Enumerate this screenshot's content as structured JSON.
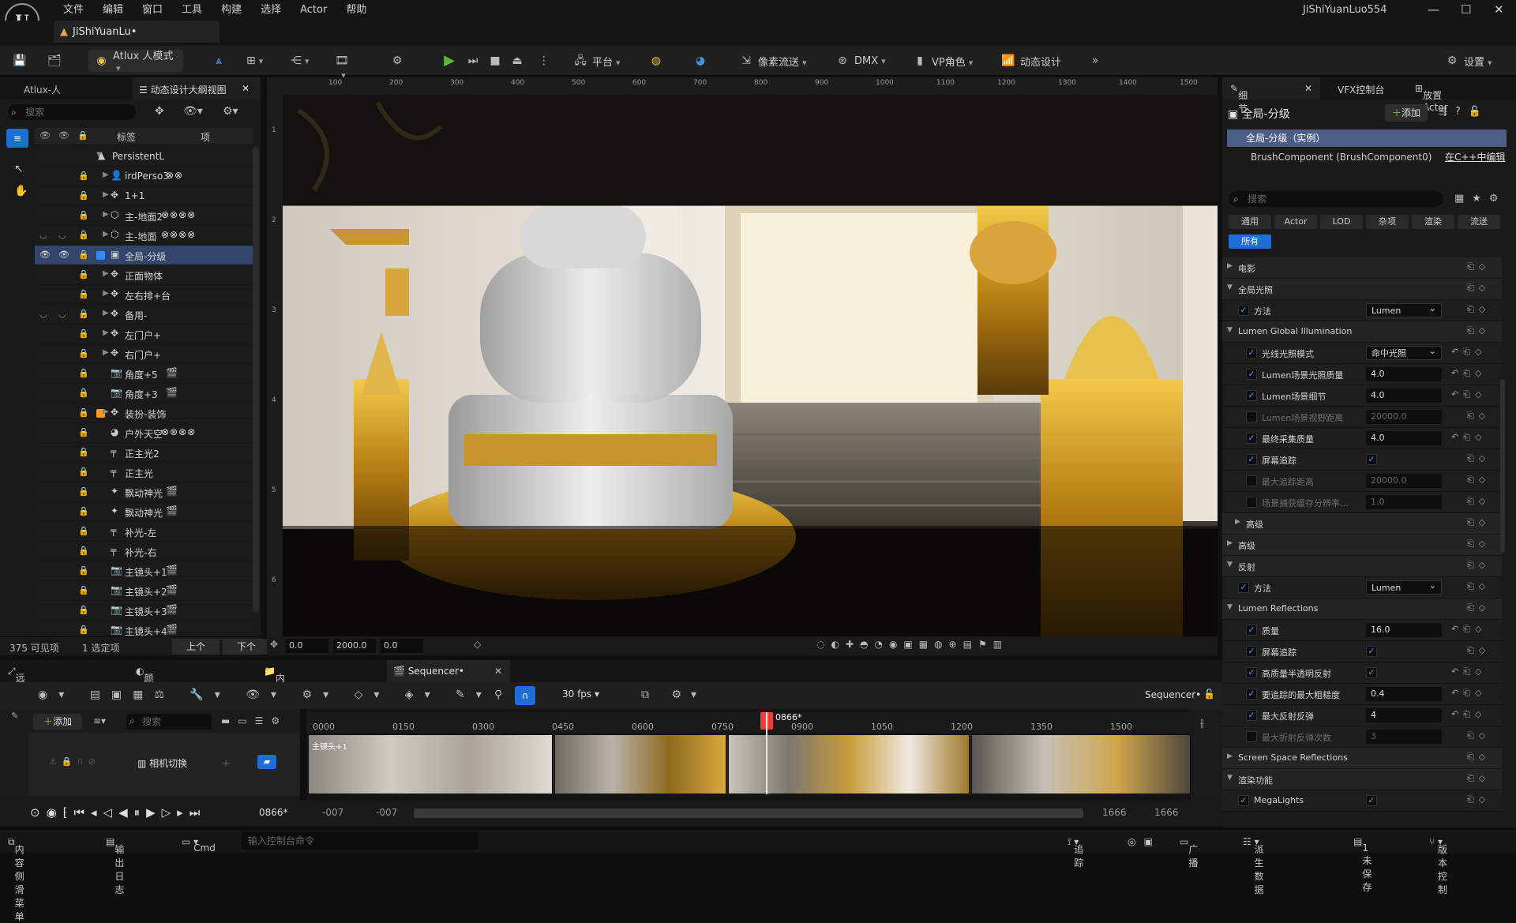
{
  "menubar": {
    "logo": "U",
    "items": [
      "文件",
      "编辑",
      "窗口",
      "工具",
      "构建",
      "选择",
      "Actor",
      "帮助"
    ],
    "user": "JiShiYuanLuo554",
    "project_tab": "JiShiYuanLu•"
  },
  "toolbar": {
    "mode": "Atlux 人模式",
    "platform": "平台",
    "pixel_stream": "像素流送",
    "dmx": "DMX",
    "vp_role": "VP角色",
    "motion_design": "动态设计",
    "settings": "设置"
  },
  "left_panel": {
    "tab1": "Atlux-人",
    "tab2": "动态设计大纲视图",
    "search_placeholder": "搜索",
    "col_label": "标签",
    "col_item": "项",
    "rows": [
      {
        "label": "PersistentL",
        "icon": "level-icon",
        "indent": 0,
        "expanded": true
      },
      {
        "label": "irdPerso3",
        "icon": "person-icon",
        "ext": "⊗⊗"
      },
      {
        "label": "1+1",
        "icon": "move-icon"
      },
      {
        "label": "主-地面2",
        "icon": "mesh-icon",
        "ext": "⊗⊗⊗⊗"
      },
      {
        "label": "主-地面",
        "icon": "mesh-icon",
        "ext": "⊗⊗⊗⊗",
        "eyes": true
      },
      {
        "label": "全局-分级",
        "icon": "grading-icon",
        "selected": true,
        "swatch": "#2f8cff"
      },
      {
        "label": "正面物体",
        "icon": "move-icon"
      },
      {
        "label": "左右排+台",
        "icon": "move-icon"
      },
      {
        "label": "备用-",
        "icon": "move-icon",
        "eyes": true
      },
      {
        "label": "左门户+",
        "icon": "move-icon"
      },
      {
        "label": "右门户+",
        "icon": "move-icon"
      },
      {
        "label": "角度+5",
        "icon": "camera-icon",
        "ext": "🎬"
      },
      {
        "label": "角度+3",
        "icon": "camera-icon",
        "ext": "🎬"
      },
      {
        "label": "装扮-装饰",
        "icon": "move-icon",
        "swatch": "#ff9a1a"
      },
      {
        "label": "户外天空",
        "icon": "sky-icon",
        "ext": "⊗⊗⊗⊗"
      },
      {
        "label": "正主光2",
        "icon": "light-icon"
      },
      {
        "label": "正主光",
        "icon": "light-icon"
      },
      {
        "label": "飘动神光",
        "icon": "spot-icon",
        "ext": "🎬"
      },
      {
        "label": "飘动神光",
        "icon": "spot-icon",
        "ext": "🎬"
      },
      {
        "label": "补光-左",
        "icon": "light-icon"
      },
      {
        "label": "补光-右",
        "icon": "light-icon"
      },
      {
        "label": "主镜头+1",
        "icon": "camera-icon",
        "ext": "🎬"
      },
      {
        "label": "主镜头+2",
        "icon": "camera-icon",
        "ext": "🎬"
      },
      {
        "label": "主镜头+3",
        "icon": "camera-icon",
        "ext": "🎬"
      },
      {
        "label": "主镜头+4",
        "icon": "camera-icon",
        "ext": "🎬"
      }
    ],
    "footer": {
      "count": "375 可见项",
      "selected": "1 选定项",
      "prev": "上个",
      "next": "下个"
    }
  },
  "viewport": {
    "ruler_h": [
      "100",
      "200",
      "300",
      "400",
      "500",
      "600",
      "700",
      "800",
      "900",
      "1000",
      "1100",
      "1200",
      "1300",
      "1400",
      "1500"
    ],
    "ruler_v": [
      "1",
      "2",
      "3",
      "4",
      "5",
      "6"
    ],
    "footer": {
      "f1": "0.0",
      "f2": "2000.0",
      "f3": "0.0"
    }
  },
  "right_panel": {
    "tabs": [
      "细节",
      "VFX控制台",
      "放置Actor"
    ],
    "title": "全局-分级",
    "add": "添加",
    "instance": "全局-分级（实例）",
    "component": "BrushComponent (BrushComponent0)",
    "edit_cpp": "在C++中编辑",
    "search_placeholder": "搜索",
    "chips": [
      "通用",
      "Actor",
      "LOD",
      "杂项",
      "渲染",
      "流送",
      "所有"
    ],
    "props": [
      {
        "type": "cat",
        "label": "电影",
        "collapsed": true
      },
      {
        "type": "cat",
        "label": "全局光照"
      },
      {
        "type": "prop",
        "label": "方法",
        "checked": true,
        "sel": "Lumen",
        "indent": 1
      },
      {
        "type": "cat",
        "label": "Lumen Global Illumination",
        "indent": 0
      },
      {
        "type": "prop",
        "label": "光线光照模式",
        "checked": true,
        "sel": "命中光照",
        "indent": 2,
        "reset": true
      },
      {
        "type": "prop",
        "label": "Lumen场景光照质量",
        "checked": true,
        "val": "4.0",
        "indent": 2,
        "reset": true
      },
      {
        "type": "prop",
        "label": "Lumen场景细节",
        "checked": true,
        "val": "4.0",
        "indent": 2,
        "reset": true
      },
      {
        "type": "prop",
        "label": "Lumen场景视野距离",
        "checked": false,
        "val": "20000.0",
        "indent": 2,
        "dis": true
      },
      {
        "type": "prop",
        "label": "最终采集质量",
        "checked": true,
        "val": "4.0",
        "indent": 2,
        "reset": true
      },
      {
        "type": "prop",
        "label": "屏幕追踪",
        "checked": true,
        "vcb": true,
        "indent": 2
      },
      {
        "type": "prop",
        "label": "最大追踪距离",
        "checked": false,
        "val": "20000.0",
        "indent": 2,
        "dis": true
      },
      {
        "type": "prop",
        "label": "场景捕获缓存分辨率...",
        "checked": false,
        "val": "1.0",
        "indent": 2,
        "dis": true
      },
      {
        "type": "cat",
        "label": "高级",
        "indent": 1,
        "collapsed": true
      },
      {
        "type": "cat",
        "label": "高级",
        "collapsed": true
      },
      {
        "type": "cat",
        "label": "反射"
      },
      {
        "type": "prop",
        "label": "方法",
        "checked": true,
        "sel": "Lumen",
        "indent": 1
      },
      {
        "type": "cat",
        "label": "Lumen Reflections"
      },
      {
        "type": "prop",
        "label": "质量",
        "checked": true,
        "val": "16.0",
        "indent": 2,
        "reset": true
      },
      {
        "type": "prop",
        "label": "屏幕追踪",
        "checked": true,
        "vcb": true,
        "indent": 2
      },
      {
        "type": "prop",
        "label": "高质量半透明反射",
        "checked": true,
        "vcb": true,
        "indent": 2,
        "reset": true
      },
      {
        "type": "prop",
        "label": "要追踪的最大粗糙度",
        "checked": true,
        "val": "0.4",
        "indent": 2,
        "reset": true
      },
      {
        "type": "prop",
        "label": "最大反射反弹",
        "checked": true,
        "val": "4",
        "indent": 2,
        "reset": true
      },
      {
        "type": "prop",
        "label": "最大折射反弹次数",
        "checked": false,
        "val": "3",
        "indent": 2,
        "dis": true
      },
      {
        "type": "cat",
        "label": "Screen Space Reflections",
        "collapsed": true
      },
      {
        "type": "cat",
        "label": "渲染功能"
      },
      {
        "type": "prop",
        "label": "MegaLights",
        "checked": true,
        "vcb": true,
        "indent": 1
      }
    ]
  },
  "bottom": {
    "tabs": [
      "远程控制",
      "颜色分级",
      "内容浏览器",
      "Sequencer•"
    ],
    "fps": "30 fps",
    "seq_label": "Sequencer•",
    "add": "添加",
    "search_placeholder": "搜索",
    "track": "相机切换",
    "ruler": [
      "0000",
      "0150",
      "0300",
      "0450",
      "0600",
      "0750",
      "0900",
      "1050",
      "1200",
      "1350",
      "1500"
    ],
    "playhead": "0866*",
    "current_frame": "0866*",
    "range_start": "-007",
    "range_start2": "-007",
    "range_end": "1666",
    "range_end2": "1666",
    "thumb_label": "主镜头+1"
  },
  "statusbar": {
    "drawer": "内容侧滑菜单",
    "log": "输出日志",
    "cmd": "Cmd",
    "cmd_placeholder": "输入控制台命令",
    "trace": "追踪",
    "broadcast": "广播",
    "derived": "派生数据",
    "unsaved": "1未保存",
    "vcs": "版本控制"
  }
}
